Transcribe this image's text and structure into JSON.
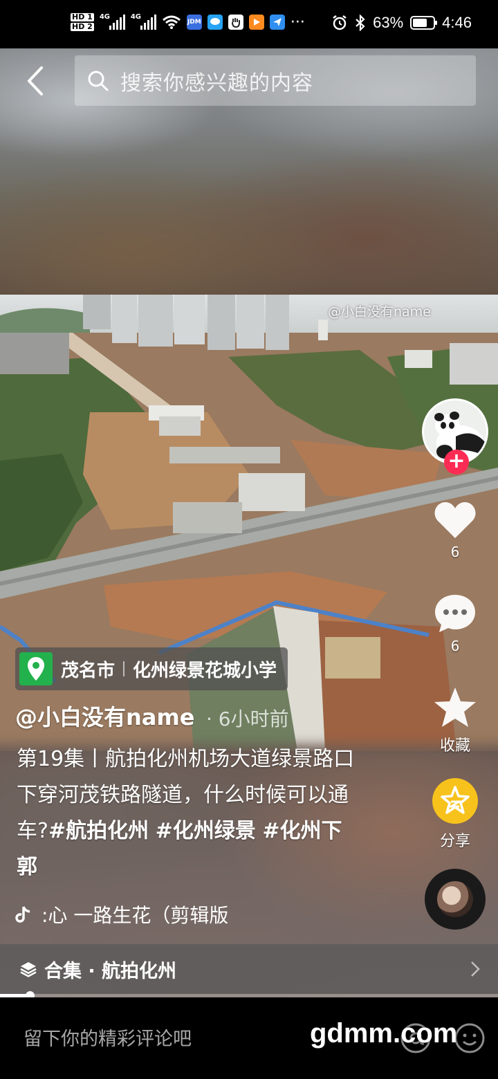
{
  "status_bar": {
    "hd1": "HD 1",
    "hd2": "HD 2",
    "net1": "4G",
    "net2": "4G",
    "battery": "63%",
    "battery_level": 0.63,
    "time": "4:46",
    "more": "···",
    "app_icon_jdm": "JDM"
  },
  "search": {
    "placeholder": "搜索你感兴趣的内容"
  },
  "video": {
    "watermark": "@小白没有name"
  },
  "rail": {
    "like_count": "6",
    "comment_count": "6",
    "favorite_label": "收藏",
    "share_label": "分享",
    "follow_symbol": "+"
  },
  "location": {
    "city": "茂名市",
    "place": "化州绿景花城小学"
  },
  "post": {
    "author": "@小白没有name",
    "time": "· 6小时前",
    "desc_text": "第19集丨航拍化州机场大道绿景路口下穿河茂铁路隧道，什么时候可以通车?",
    "tags": [
      "#航拍化州",
      "#化州绿景",
      "#化州下郭"
    ]
  },
  "music": {
    "title": ":心    一路生花（剪辑版"
  },
  "collection": {
    "label": "合集 · 航拍化州"
  },
  "playback": {
    "progress": 0.06
  },
  "bottom": {
    "comment_placeholder": "留下你的精彩评论吧",
    "site_watermark": "gdmm.com"
  },
  "colors": {
    "like_red": "#fe2c55",
    "share_yellow": "#f7c21c",
    "location_green": "#22b14c"
  }
}
